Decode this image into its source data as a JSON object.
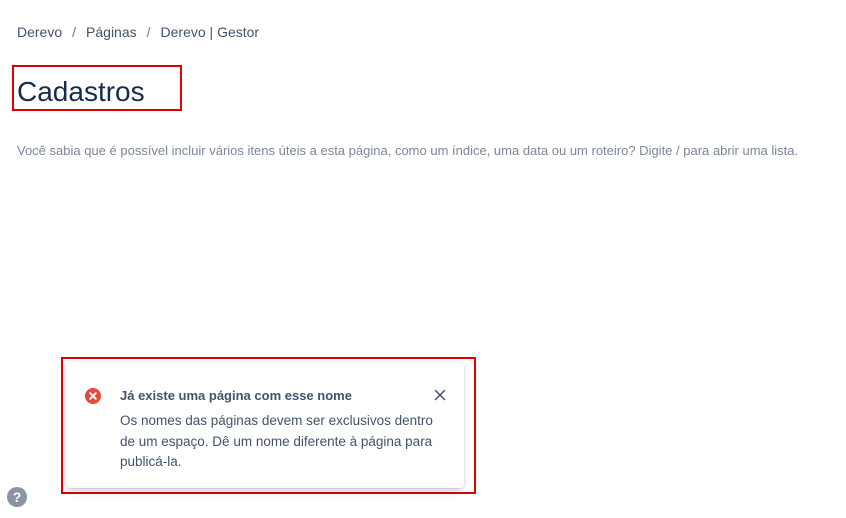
{
  "breadcrumb": {
    "items": [
      "Derevo",
      "Páginas",
      "Derevo | Gestor"
    ],
    "separator": "/"
  },
  "page": {
    "title": "Cadastros",
    "placeholder": "Você sabia que é possível incluir vários itens úteis a esta página, como um índice, uma data ou um roteiro? Digite / para abrir uma lista."
  },
  "flag": {
    "icon": "error-icon",
    "title": "Já existe uma página com esse nome",
    "body": "Os nomes das páginas devem ser exclusivos dentro de um espaço. Dê um nome diferente à página para publicá-la.",
    "close_icon": "close-icon",
    "error_color": "#e5493a"
  },
  "help": {
    "icon": "help-icon",
    "glyph": "?"
  },
  "colors": {
    "highlight": "#e00000",
    "text": "#172b4d",
    "muted": "#7a869a"
  }
}
